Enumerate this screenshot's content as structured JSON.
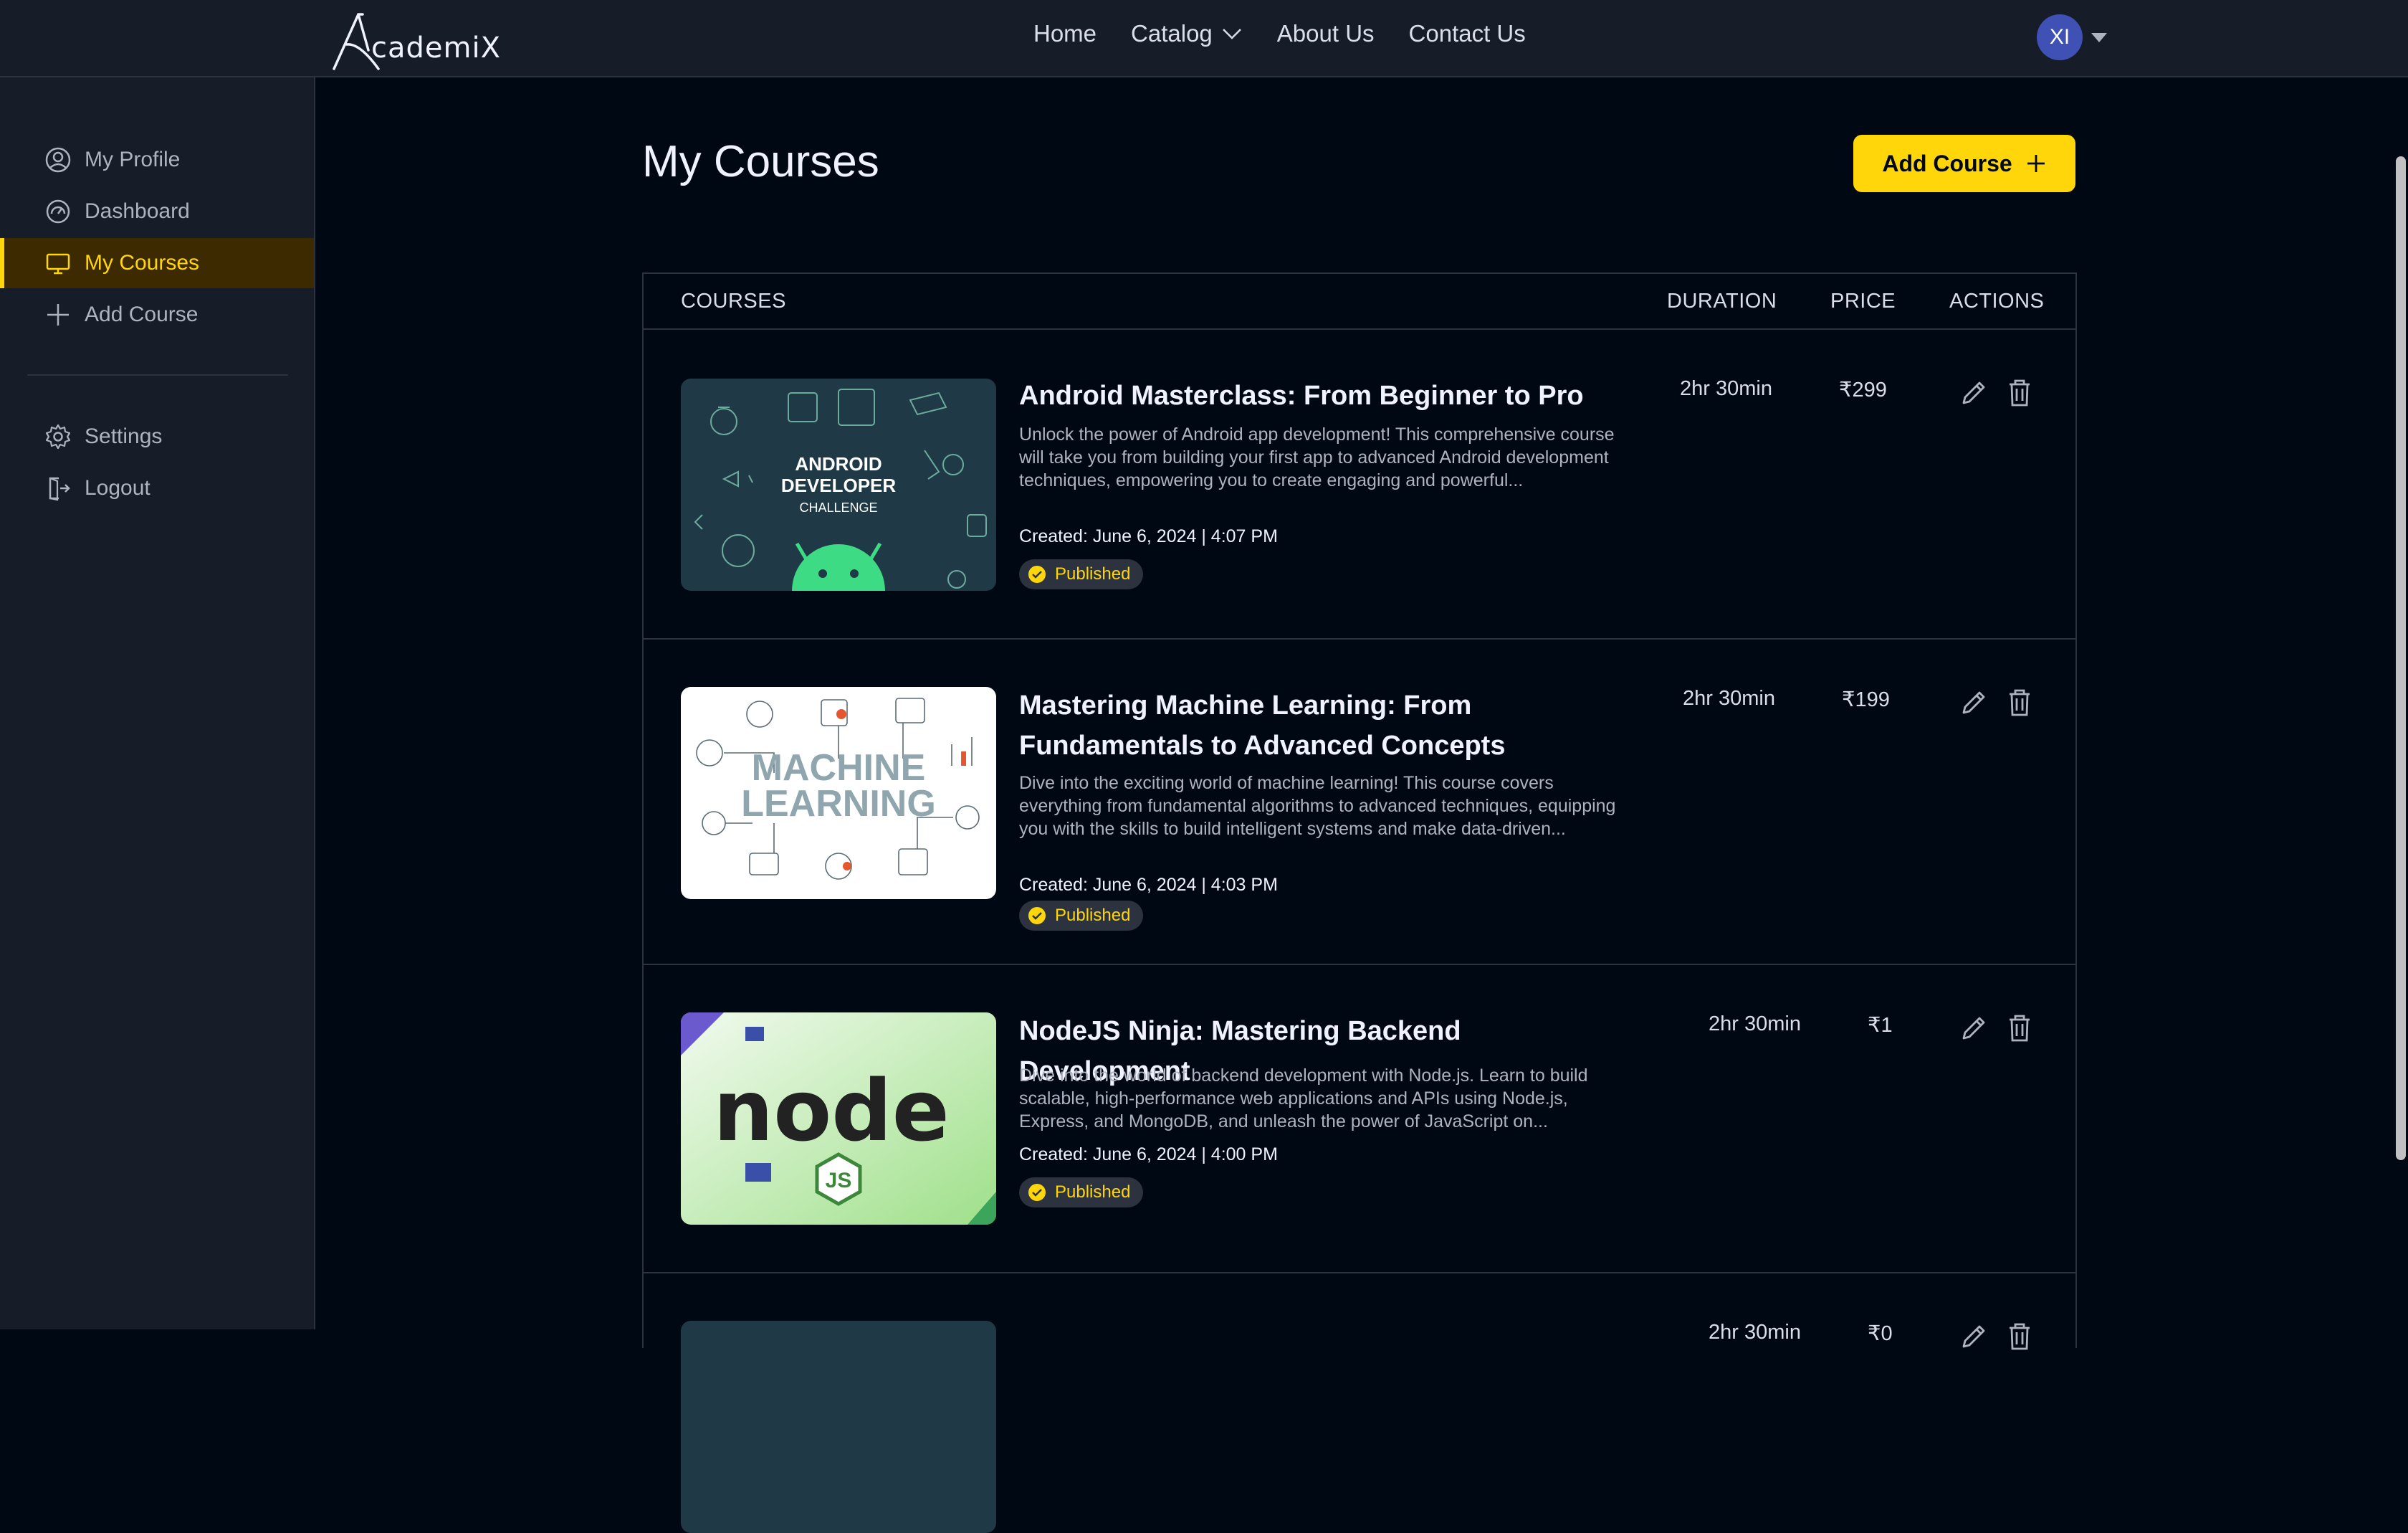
{
  "brand": {
    "logo_text": "cademiX"
  },
  "nav": {
    "links": [
      "Home",
      "Catalog",
      "About Us",
      "Contact Us"
    ],
    "avatar_initials": "XI"
  },
  "sidebar": {
    "items": [
      {
        "label": "My Profile",
        "icon": "user-circle-icon",
        "active": false
      },
      {
        "label": "Dashboard",
        "icon": "gauge-icon",
        "active": false
      },
      {
        "label": "My Courses",
        "icon": "monitor-icon",
        "active": true
      },
      {
        "label": "Add Course",
        "icon": "plus-icon",
        "active": false
      }
    ],
    "bottom_items": [
      {
        "label": "Settings",
        "icon": "gear-icon"
      },
      {
        "label": "Logout",
        "icon": "logout-icon"
      }
    ]
  },
  "main": {
    "title": "My Courses",
    "add_button_label": "Add Course"
  },
  "table": {
    "headers": {
      "courses": "COURSES",
      "duration": "DURATION",
      "price": "PRICE",
      "actions": "ACTIONS"
    },
    "rows": [
      {
        "title": "Android Masterclass: From Beginner to Pro",
        "description": "Unlock the power of Android app development! This comprehensive course will take you from building your first app to advanced Android development techniques, empowering you to create engaging and powerful...",
        "created": "Created: June 6, 2024 | 4:07 PM",
        "status": "Published",
        "duration": "2hr 30min",
        "price": "₹299",
        "thumb_text": [
          "ANDROID",
          "DEVELOPER",
          "CHALLENGE"
        ]
      },
      {
        "title": "Mastering Machine Learning: From Fundamentals to Advanced Concepts",
        "description": "Dive into the exciting world of machine learning! This course covers everything from fundamental algorithms to advanced techniques, equipping you with the skills to build intelligent systems and make data-driven...",
        "created": "Created: June 6, 2024 | 4:03 PM",
        "status": "Published",
        "duration": "2hr 30min",
        "price": "₹199",
        "thumb_text": [
          "MACHINE",
          "LEARNING"
        ]
      },
      {
        "title": "NodeJS Ninja: Mastering Backend Development",
        "description": "Dive into the world of backend development with Node.js. Learn to build scalable, high-performance web applications and APIs using Node.js, Express, and MongoDB, and unleash the power of JavaScript on...",
        "created": "Created: June 6, 2024 | 4:00 PM",
        "status": "Published",
        "duration": "2hr 30min",
        "price": "₹1",
        "thumb_text": [
          "node",
          "JS"
        ]
      },
      {
        "title": "",
        "description": "",
        "created": "",
        "status": "",
        "duration": "2hr 30min",
        "price": "₹0"
      }
    ]
  },
  "colors": {
    "background": "#000814",
    "panel": "#161D29",
    "border": "#2C333F",
    "accent": "#FFD60A",
    "text": "#F1F2FF",
    "muted": "#AFB2BF"
  }
}
